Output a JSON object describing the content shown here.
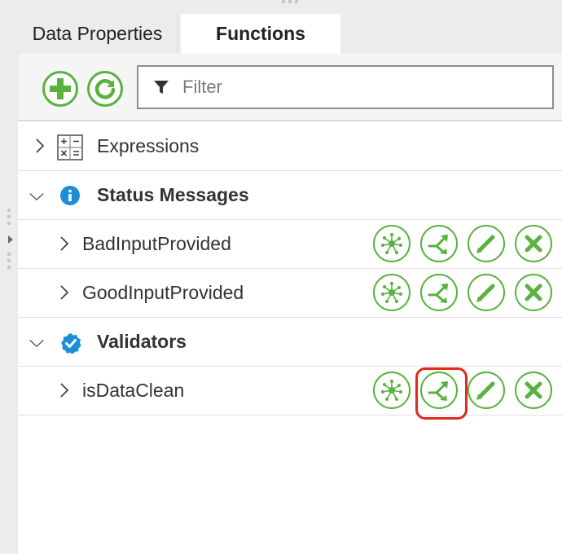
{
  "tabs": [
    {
      "label": "Data Properties",
      "active": false
    },
    {
      "label": "Functions",
      "active": true
    }
  ],
  "toolbar": {
    "add_icon": "plus-icon",
    "refresh_icon": "refresh-icon",
    "filter_placeholder": "Filter",
    "filter_value": ""
  },
  "tree": {
    "expressions": {
      "label": "Expressions",
      "expanded": false,
      "icon": "calculator-icon"
    },
    "status_messages": {
      "label": "Status Messages",
      "expanded": true,
      "icon": "info-icon",
      "items": [
        {
          "label": "BadInputProvided"
        },
        {
          "label": "GoodInputProvided"
        }
      ]
    },
    "validators": {
      "label": "Validators",
      "expanded": true,
      "icon": "check-badge-icon",
      "items": [
        {
          "label": "isDataClean"
        }
      ]
    }
  },
  "row_actions": [
    "network-icon",
    "branch-arrow-icon",
    "edit-pencil-icon",
    "delete-x-icon"
  ],
  "colors": {
    "accent_green": "#5ab140",
    "info_blue": "#1a8fd6",
    "highlight_red": "#e12a1a"
  }
}
